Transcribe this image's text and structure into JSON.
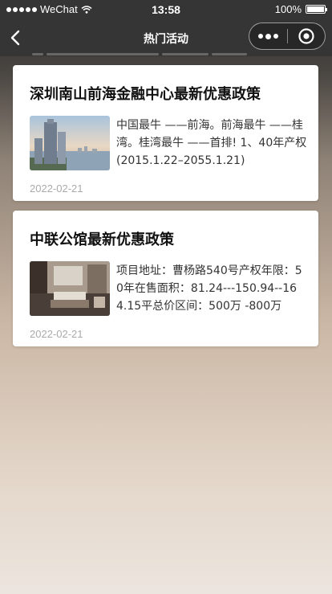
{
  "status_bar": {
    "carrier": "WeChat",
    "time": "13:58",
    "battery": "100%",
    "battery_level": 1.0
  },
  "nav": {
    "title": "热门活动"
  },
  "articles": [
    {
      "title": "深圳南山前海金融中心最新优惠政策",
      "excerpt": "中国最牛 ——前海。前海最牛 ——桂湾。桂湾最牛 ——首排! 1、40年产权(2015.1.22–2055.1.21)",
      "date": "2022-02-21",
      "thumb_icon": "city-skyline-photo"
    },
    {
      "title": "中联公馆最新优惠政策",
      "excerpt": "项目地址：曹杨路540号产权年限：50年在售面积：81.24---150.94--164.15平总价区间：500万 -800万",
      "date": "2022-02-21",
      "thumb_icon": "interior-room-photo"
    }
  ]
}
